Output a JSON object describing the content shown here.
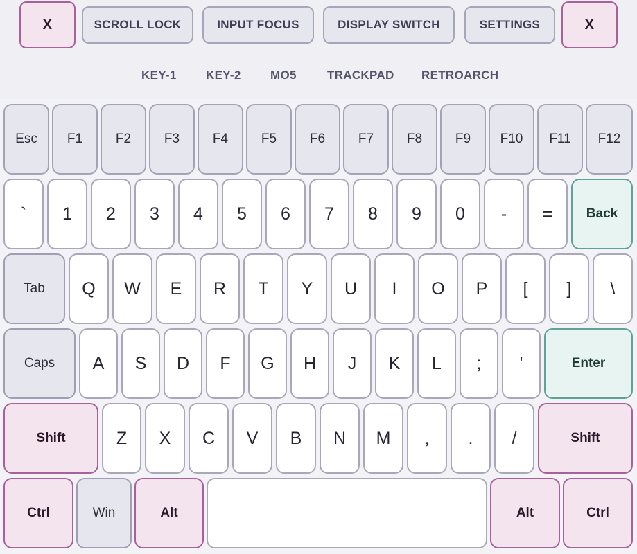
{
  "toolbar": {
    "close_left": "X",
    "scroll_lock": "SCROLL LOCK",
    "input_focus": "INPUT FOCUS",
    "display_switch": "DISPLAY SWITCH",
    "settings": "SETTINGS",
    "close_right": "X"
  },
  "mode_tabs": {
    "key1": "KEY-1",
    "key2": "KEY-2",
    "mo5": "MO5",
    "trackpad": "TRACKPAD",
    "retroarch": "RETROARCH"
  },
  "keys": {
    "esc": "Esc",
    "f1": "F1",
    "f2": "F2",
    "f3": "F3",
    "f4": "F4",
    "f5": "F5",
    "f6": "F6",
    "f7": "F7",
    "f8": "F8",
    "f9": "F9",
    "f10": "F10",
    "f11": "F11",
    "f12": "F12",
    "backtick": "`",
    "n1": "1",
    "n2": "2",
    "n3": "3",
    "n4": "4",
    "n5": "5",
    "n6": "6",
    "n7": "7",
    "n8": "8",
    "n9": "9",
    "n0": "0",
    "minus": "-",
    "equals": "=",
    "back": "Back",
    "tab": "Tab",
    "q": "Q",
    "w": "W",
    "e": "E",
    "r": "R",
    "t": "T",
    "y": "Y",
    "u": "U",
    "i": "I",
    "o": "O",
    "p": "P",
    "lbracket": "[",
    "rbracket": "]",
    "backslash": "\\",
    "caps": "Caps",
    "a": "A",
    "s": "S",
    "d": "D",
    "f": "F",
    "g": "G",
    "h": "H",
    "j": "J",
    "k": "K",
    "l": "L",
    "semicolon": ";",
    "quote": "'",
    "enter": "Enter",
    "shift_left": "Shift",
    "z": "Z",
    "x": "X",
    "c": "C",
    "v": "V",
    "b": "B",
    "n": "N",
    "m": "M",
    "comma": ",",
    "period": ".",
    "slash": "/",
    "shift_right": "Shift",
    "ctrl_left": "Ctrl",
    "win": "Win",
    "alt_left": "Alt",
    "space": "",
    "alt_right": "Alt",
    "ctrl_right": "Ctrl"
  },
  "colors": {
    "background": "#f3f2f7",
    "key_face": "#ffffff",
    "key_border": "#a9a8b9",
    "function_key_face": "#e6e6ef",
    "accent_teal": "#5fa397",
    "accent_pink": "#a8619a"
  }
}
